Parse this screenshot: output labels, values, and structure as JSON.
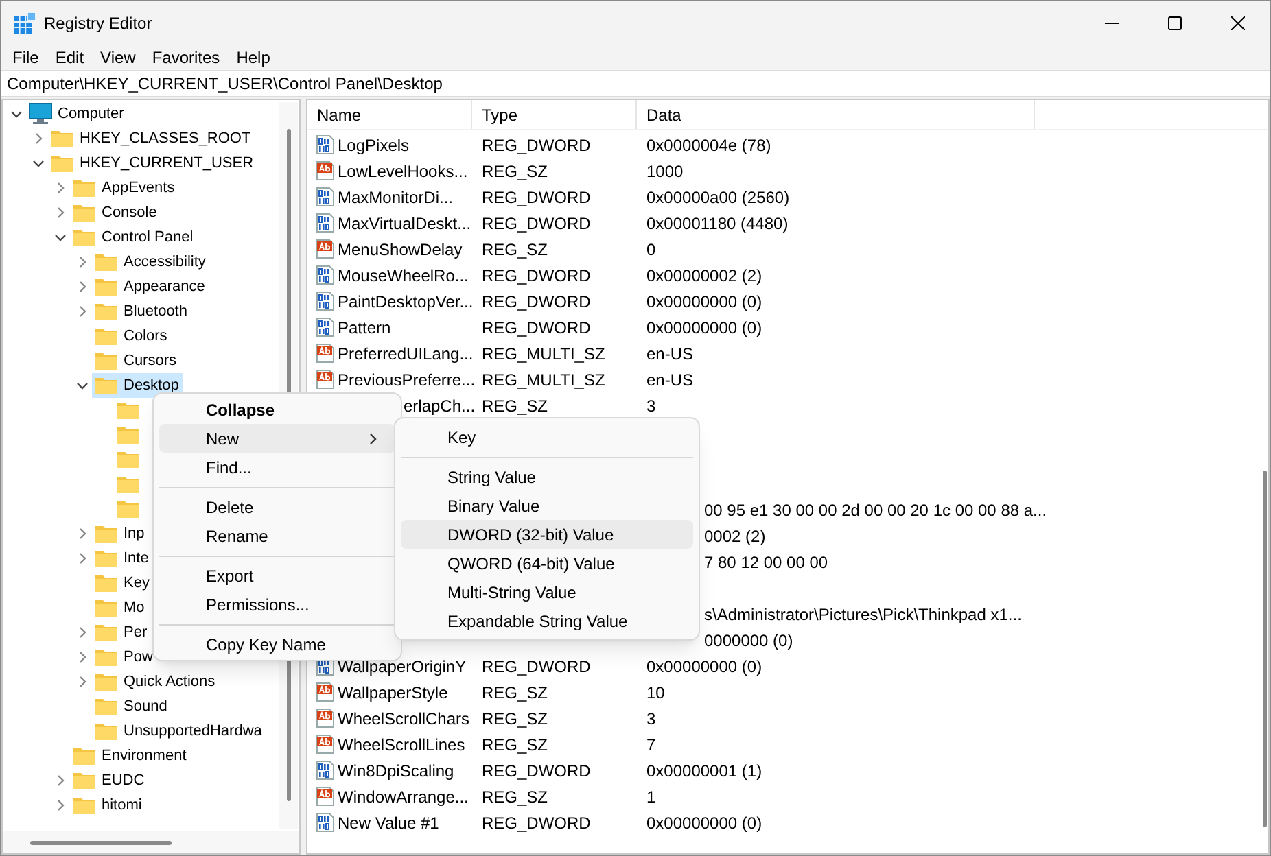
{
  "window": {
    "title": "Registry Editor"
  },
  "menu_bar": [
    "File",
    "Edit",
    "View",
    "Favorites",
    "Help"
  ],
  "address": "Computer\\HKEY_CURRENT_USER\\Control Panel\\Desktop",
  "tree": [
    {
      "label": "Computer",
      "kind": "computer",
      "expanded": true,
      "selected": false,
      "children": [
        {
          "label": "HKEY_CLASSES_ROOT",
          "expanded": false,
          "selected": false
        },
        {
          "label": "HKEY_CURRENT_USER",
          "expanded": true,
          "selected": false,
          "children": [
            {
              "label": "AppEvents",
              "expanded": false,
              "selected": false
            },
            {
              "label": "Console",
              "expanded": false,
              "selected": false
            },
            {
              "label": "Control Panel",
              "expanded": true,
              "selected": false,
              "children": [
                {
                  "label": "Accessibility",
                  "expanded": false,
                  "selected": false
                },
                {
                  "label": "Appearance",
                  "expanded": false,
                  "selected": false
                },
                {
                  "label": "Bluetooth",
                  "expanded": false,
                  "selected": false
                },
                {
                  "label": "Colors",
                  "selected": false
                },
                {
                  "label": "Cursors",
                  "selected": false
                },
                {
                  "label": "Desktop",
                  "expanded": true,
                  "selected": true,
                  "children": [
                    {
                      "selected": false
                    },
                    {
                      "selected": false
                    },
                    {
                      "selected": false
                    },
                    {
                      "selected": false
                    },
                    {
                      "selected": false
                    }
                  ]
                },
                {
                  "label": "Inp",
                  "expanded": false,
                  "selected": false
                },
                {
                  "label": "Inte",
                  "expanded": false,
                  "selected": false
                },
                {
                  "label": "Key",
                  "selected": false
                },
                {
                  "label": "Mo",
                  "selected": false
                },
                {
                  "label": "Per",
                  "expanded": false,
                  "selected": false
                },
                {
                  "label": "Pow",
                  "expanded": false,
                  "selected": false
                },
                {
                  "label": "Quick Actions",
                  "expanded": false,
                  "selected": false
                },
                {
                  "label": "Sound",
                  "selected": false
                },
                {
                  "label": "UnsupportedHardwa",
                  "selected": false
                }
              ]
            },
            {
              "label": "Environment",
              "selected": false
            },
            {
              "label": "EUDC",
              "expanded": false,
              "selected": false
            },
            {
              "label": "hitomi",
              "expanded": false,
              "selected": false
            }
          ]
        }
      ]
    }
  ],
  "table": {
    "columns": [
      "Name",
      "Type",
      "Data"
    ],
    "rows": [
      {
        "kind": "dword",
        "name": "LogPixels",
        "type": "REG_DWORD",
        "data": "0x0000004e (78)"
      },
      {
        "kind": "string",
        "name": "LowLevelHooks...",
        "type": "REG_SZ",
        "data": "1000"
      },
      {
        "kind": "dword",
        "name": "MaxMonitorDi...",
        "type": "REG_DWORD",
        "data": "0x00000a00 (2560)"
      },
      {
        "kind": "dword",
        "name": "MaxVirtualDeskt...",
        "type": "REG_DWORD",
        "data": "0x00001180 (4480)"
      },
      {
        "kind": "string",
        "name": "MenuShowDelay",
        "type": "REG_SZ",
        "data": "0"
      },
      {
        "kind": "dword",
        "name": "MouseWheelRo...",
        "type": "REG_DWORD",
        "data": "0x00000002 (2)"
      },
      {
        "kind": "dword",
        "name": "PaintDesktopVer...",
        "type": "REG_DWORD",
        "data": "0x00000000 (0)"
      },
      {
        "kind": "dword",
        "name": "Pattern",
        "type": "REG_DWORD",
        "data": "0x00000000 (0)"
      },
      {
        "kind": "string",
        "name": "PreferredUILang...",
        "type": "REG_MULTI_SZ",
        "data": "en-US"
      },
      {
        "kind": "string",
        "name": "PreviousPreferre...",
        "type": "REG_MULTI_SZ",
        "data": "en-US"
      },
      {
        "kind": "name-clipped",
        "name": "erlapCh...",
        "type": "REG_SZ",
        "data": "3"
      },
      {
        "kind": "hidden"
      },
      {
        "kind": "hidden"
      },
      {
        "kind": "hidden"
      },
      {
        "kind": "data-clipped",
        "data": "00 95 e1 30 00 00 2d 00 00 20 1c 00 00 88 a..."
      },
      {
        "kind": "data-clipped",
        "data": "0002 (2)"
      },
      {
        "kind": "data-clipped",
        "data": "7 80 12 00 00 00"
      },
      {
        "kind": "hidden"
      },
      {
        "kind": "data-clipped",
        "data": "s\\Administrator\\Pictures\\Pick\\Thinkpad x1..."
      },
      {
        "kind": "data-clipped",
        "data": "0000000 (0)"
      },
      {
        "kind": "dword",
        "name": "WallpaperOriginY",
        "type": "REG_DWORD",
        "data": "0x00000000 (0)"
      },
      {
        "kind": "string",
        "name": "WallpaperStyle",
        "type": "REG_SZ",
        "data": "10"
      },
      {
        "kind": "string",
        "name": "WheelScrollChars",
        "type": "REG_SZ",
        "data": "3"
      },
      {
        "kind": "string",
        "name": "WheelScrollLines",
        "type": "REG_SZ",
        "data": "7"
      },
      {
        "kind": "dword",
        "name": "Win8DpiScaling",
        "type": "REG_DWORD",
        "data": "0x00000001 (1)"
      },
      {
        "kind": "string",
        "name": "WindowArrange...",
        "type": "REG_SZ",
        "data": "1"
      },
      {
        "kind": "dword",
        "name": "New Value #1",
        "type": "REG_DWORD",
        "data": "0x00000000 (0)"
      }
    ]
  },
  "context_menu": [
    {
      "kind": "item",
      "label": "Collapse",
      "bold": true,
      "selected": false
    },
    {
      "kind": "submenu",
      "label": "New",
      "selected": true
    },
    {
      "kind": "item",
      "label": "Find...",
      "selected": false
    },
    {
      "kind": "separator"
    },
    {
      "kind": "item",
      "label": "Delete",
      "selected": false
    },
    {
      "kind": "item",
      "label": "Rename",
      "selected": false
    },
    {
      "kind": "separator"
    },
    {
      "kind": "item",
      "label": "Export",
      "selected": false
    },
    {
      "kind": "item",
      "label": "Permissions...",
      "selected": false
    },
    {
      "kind": "separator"
    },
    {
      "kind": "item",
      "label": "Copy Key Name",
      "selected": false
    }
  ],
  "submenu": [
    {
      "kind": "item",
      "label": "Key",
      "selected": false
    },
    {
      "kind": "separator"
    },
    {
      "kind": "item",
      "label": "String Value",
      "selected": false
    },
    {
      "kind": "item",
      "label": "Binary Value",
      "selected": false
    },
    {
      "kind": "item",
      "label": "DWORD (32-bit) Value",
      "selected": true
    },
    {
      "kind": "item",
      "label": "QWORD (64-bit) Value",
      "selected": false
    },
    {
      "kind": "item",
      "label": "Multi-String Value",
      "selected": false
    },
    {
      "kind": "item",
      "label": "Expandable String Value",
      "selected": false
    }
  ]
}
